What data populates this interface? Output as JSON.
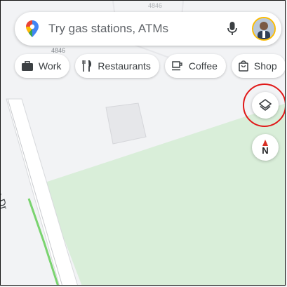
{
  "search": {
    "placeholder_text": "Try gas stations, ATMs"
  },
  "chips": [
    {
      "label": "Work",
      "icon": "briefcase-icon"
    },
    {
      "label": "Restaurants",
      "icon": "fork-knife-icon"
    },
    {
      "label": "Coffee",
      "icon": "coffee-cup-icon"
    },
    {
      "label": "Shop",
      "icon": "shopping-bag-icon"
    }
  ],
  "map": {
    "street_name": "Mason Dr",
    "address_number": "4846",
    "address_number_top": "4846",
    "colors": {
      "background": "#f2f3f5",
      "park": "#d9eed9",
      "highlighted_road": "#7ad36f",
      "building": "#e6e7ea"
    }
  },
  "controls": {
    "layers_icon": "layers-icon",
    "compass_icon": "compass-icon",
    "compass_letter": "N",
    "highlight_color": "#e01818"
  }
}
